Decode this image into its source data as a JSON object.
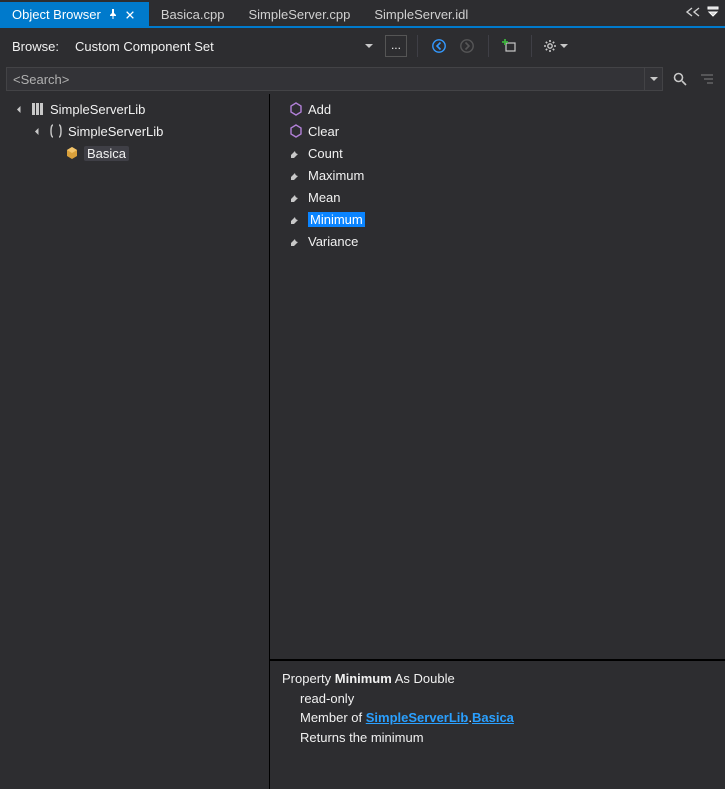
{
  "tabs": {
    "active": "Object Browser",
    "items": [
      {
        "label": "Object Browser",
        "active": true
      },
      {
        "label": "Basica.cpp",
        "active": false
      },
      {
        "label": "SimpleServer.cpp",
        "active": false
      },
      {
        "label": "SimpleServer.idl",
        "active": false
      }
    ]
  },
  "browse": {
    "label": "Browse:",
    "selection": "Custom Component Set",
    "ellipsis": "...",
    "back_icon": "back-arrow",
    "forward_icon": "forward-arrow",
    "add_icon": "add-to-references",
    "settings_icon": "gear"
  },
  "search": {
    "placeholder": "<Search>",
    "value": ""
  },
  "tree": {
    "items": [
      {
        "label": "SimpleServerLib",
        "icon": "library-icon",
        "expanded": true,
        "children": [
          {
            "label": "SimpleServerLib",
            "icon": "namespace-icon",
            "expanded": true,
            "children": [
              {
                "label": "Basica",
                "icon": "class-icon",
                "selected_style": "boxed"
              }
            ]
          }
        ]
      }
    ]
  },
  "members": [
    {
      "label": "Add",
      "icon": "method-icon"
    },
    {
      "label": "Clear",
      "icon": "method-icon"
    },
    {
      "label": "Count",
      "icon": "property-icon"
    },
    {
      "label": "Maximum",
      "icon": "property-icon"
    },
    {
      "label": "Mean",
      "icon": "property-icon"
    },
    {
      "label": "Minimum",
      "icon": "property-icon",
      "selected": true
    },
    {
      "label": "Variance",
      "icon": "property-icon"
    }
  ],
  "info": {
    "decl_prefix": "Property ",
    "decl_name": "Minimum",
    "decl_suffix": " As Double",
    "readonly": "read-only",
    "member_of_prefix": "Member of ",
    "lib_link": "SimpleServerLib",
    "dot": ".",
    "class_link": "Basica",
    "summary": "Returns the minimum"
  }
}
